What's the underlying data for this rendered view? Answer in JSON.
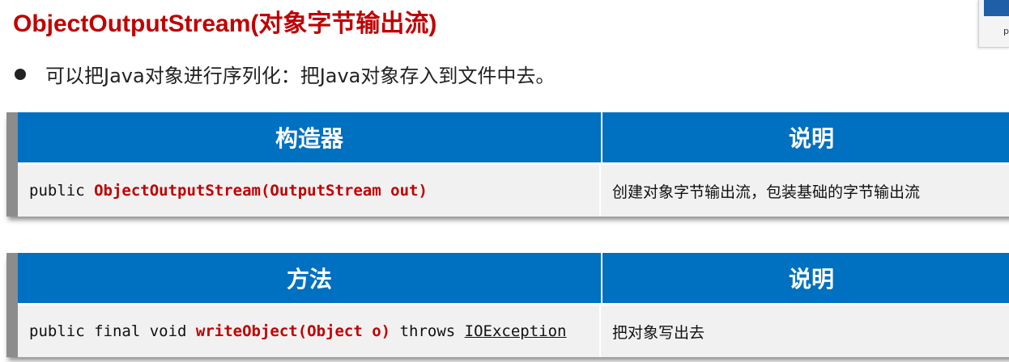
{
  "title": "ObjectOutputStream(对象字节输出流)",
  "bullet": "可以把Java对象进行序列化：把Java对象存入到文件中去。",
  "corner_widget": {
    "text": "p"
  },
  "constructor_table": {
    "headers": [
      "构造器",
      "说明"
    ],
    "row": {
      "sig_prefix": "public ",
      "sig_name": "ObjectOutputStream(OutputStream out)",
      "description": "创建对象字节输出流，包装基础的字节输出流"
    }
  },
  "method_table": {
    "headers": [
      "方法",
      "说明"
    ],
    "row": {
      "sig_prefix": "public final void ",
      "sig_name": "writeObject(Object o)",
      "sig_throws": " throws ",
      "sig_exception": "IOException",
      "description": "把对象写出去"
    }
  },
  "colors": {
    "title_red": "#c00000",
    "header_blue": "#0070c0",
    "row_gray": "#f1f1f1"
  }
}
